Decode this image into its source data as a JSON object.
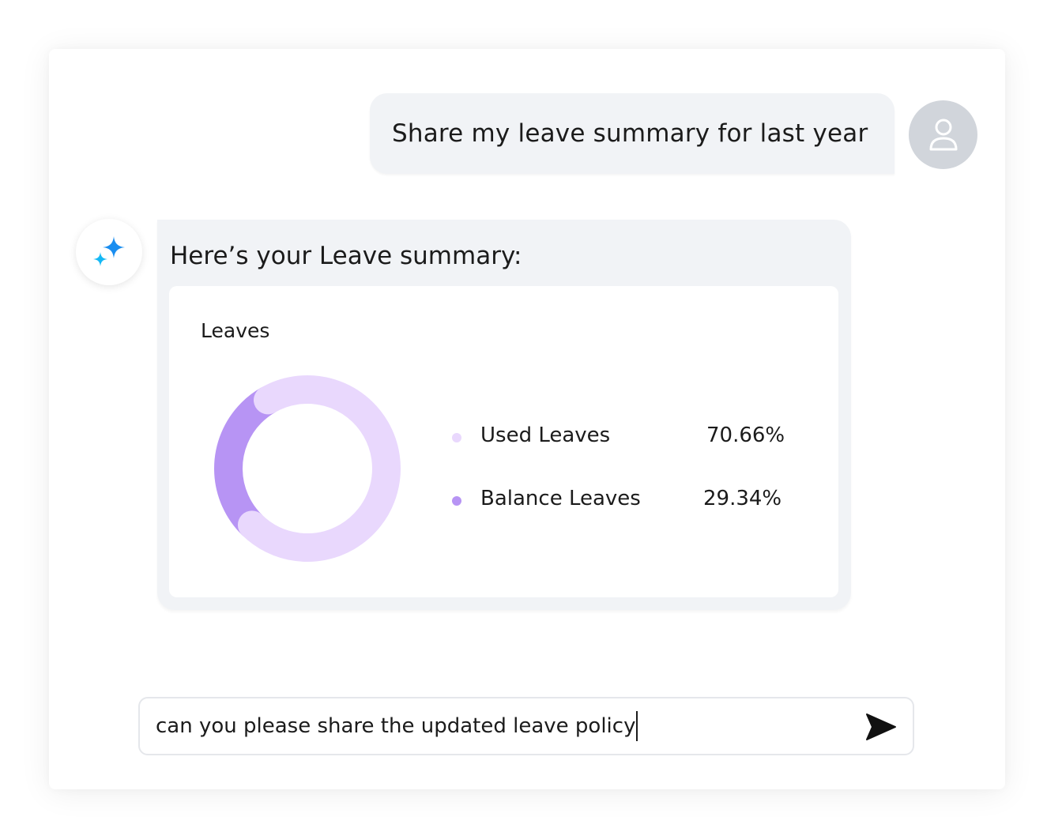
{
  "conversation": {
    "user_message": "Share my leave summary for last year",
    "ai_heading": "Here’s your Leave summary:"
  },
  "chart_data": {
    "type": "pie",
    "title": "Leaves",
    "categories": [
      "Used Leaves",
      "Balance Leaves"
    ],
    "values": [
      70.66,
      29.34
    ],
    "value_labels": [
      "70.66%",
      "29.34%"
    ],
    "colors": [
      "#e9d8fd",
      "#b794f4"
    ],
    "donut": true,
    "legend": "right"
  },
  "composer": {
    "input_value": "can you please share the updated leave policy"
  },
  "icons": {
    "user_avatar": "user-icon",
    "ai_avatar": "sparkle-icon",
    "send": "send-icon"
  },
  "colors": {
    "bubble_bg": "#f1f3f6",
    "avatar_bg": "#d1d5db",
    "sparkle_primary": "#1a8ef0",
    "sparkle_secondary": "#14b8f5"
  }
}
